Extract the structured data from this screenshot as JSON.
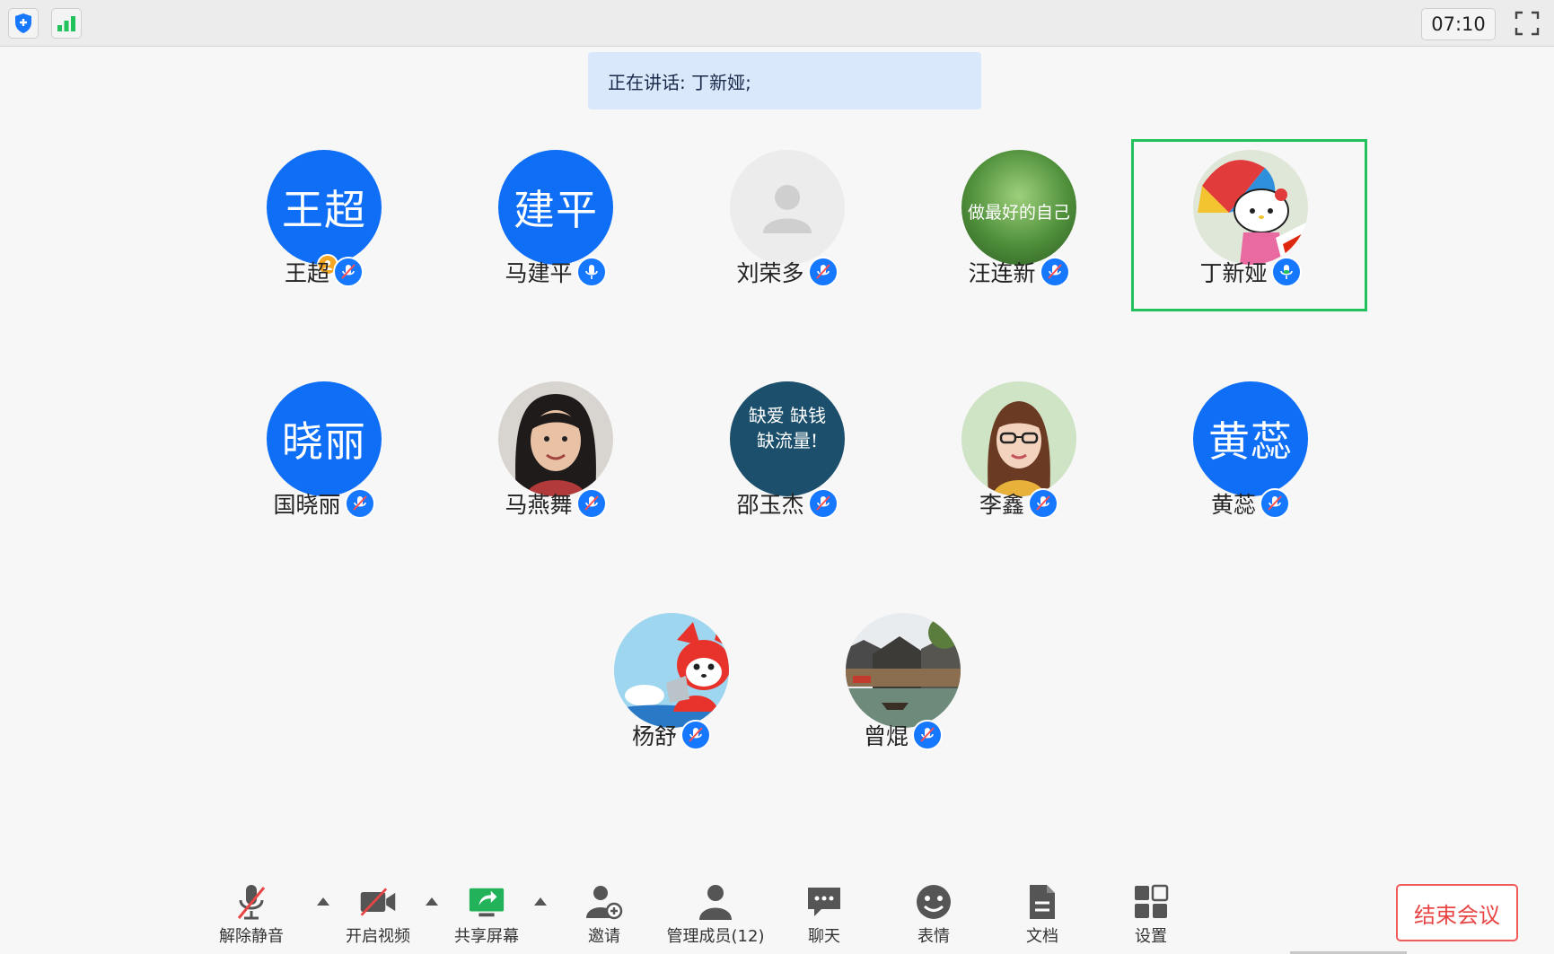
{
  "topbar": {
    "timer": "07:10"
  },
  "speaking": {
    "text": "正在讲话: 丁新娅;"
  },
  "participants": [
    {
      "name": "王超",
      "avatar_text": "王超",
      "avatar_type": "text",
      "mic": "muted",
      "host": true
    },
    {
      "name": "马建平",
      "avatar_text": "建平",
      "avatar_type": "text",
      "mic": "on"
    },
    {
      "name": "刘荣多",
      "avatar_type": "placeholder",
      "mic": "muted"
    },
    {
      "name": "汪连新",
      "avatar_type": "photo",
      "avatar_overlay": "做最好的自己",
      "mic": "muted"
    },
    {
      "name": "丁新娅",
      "avatar_type": "photo",
      "mic": "speaking",
      "active": true
    },
    {
      "name": "国晓丽",
      "avatar_text": "晓丽",
      "avatar_type": "text",
      "mic": "muted"
    },
    {
      "name": "马燕舞",
      "avatar_type": "photo",
      "mic": "muted"
    },
    {
      "name": "邵玉杰",
      "avatar_type": "photo",
      "avatar_overlay": "缺爱 缺钱 缺流量!",
      "mic": "muted"
    },
    {
      "name": "李鑫",
      "avatar_type": "photo",
      "mic": "muted"
    },
    {
      "name": "黄蕊",
      "avatar_text": "黄蕊",
      "avatar_type": "text",
      "mic": "muted"
    },
    {
      "name": "杨舒",
      "avatar_type": "photo",
      "mic": "muted"
    },
    {
      "name": "曾焜",
      "avatar_type": "photo",
      "mic": "muted"
    }
  ],
  "toolbar": {
    "unmute": "解除静音",
    "start_video": "开启视频",
    "share_screen": "共享屏幕",
    "invite": "邀请",
    "manage_members": "管理成员(12)",
    "chat": "聊天",
    "reactions": "表情",
    "docs": "文档",
    "settings": "设置",
    "end_meeting": "结束会议"
  },
  "colors": {
    "accent": "#0e6ef5",
    "active_border": "#21c15b",
    "end": "#e84545"
  }
}
